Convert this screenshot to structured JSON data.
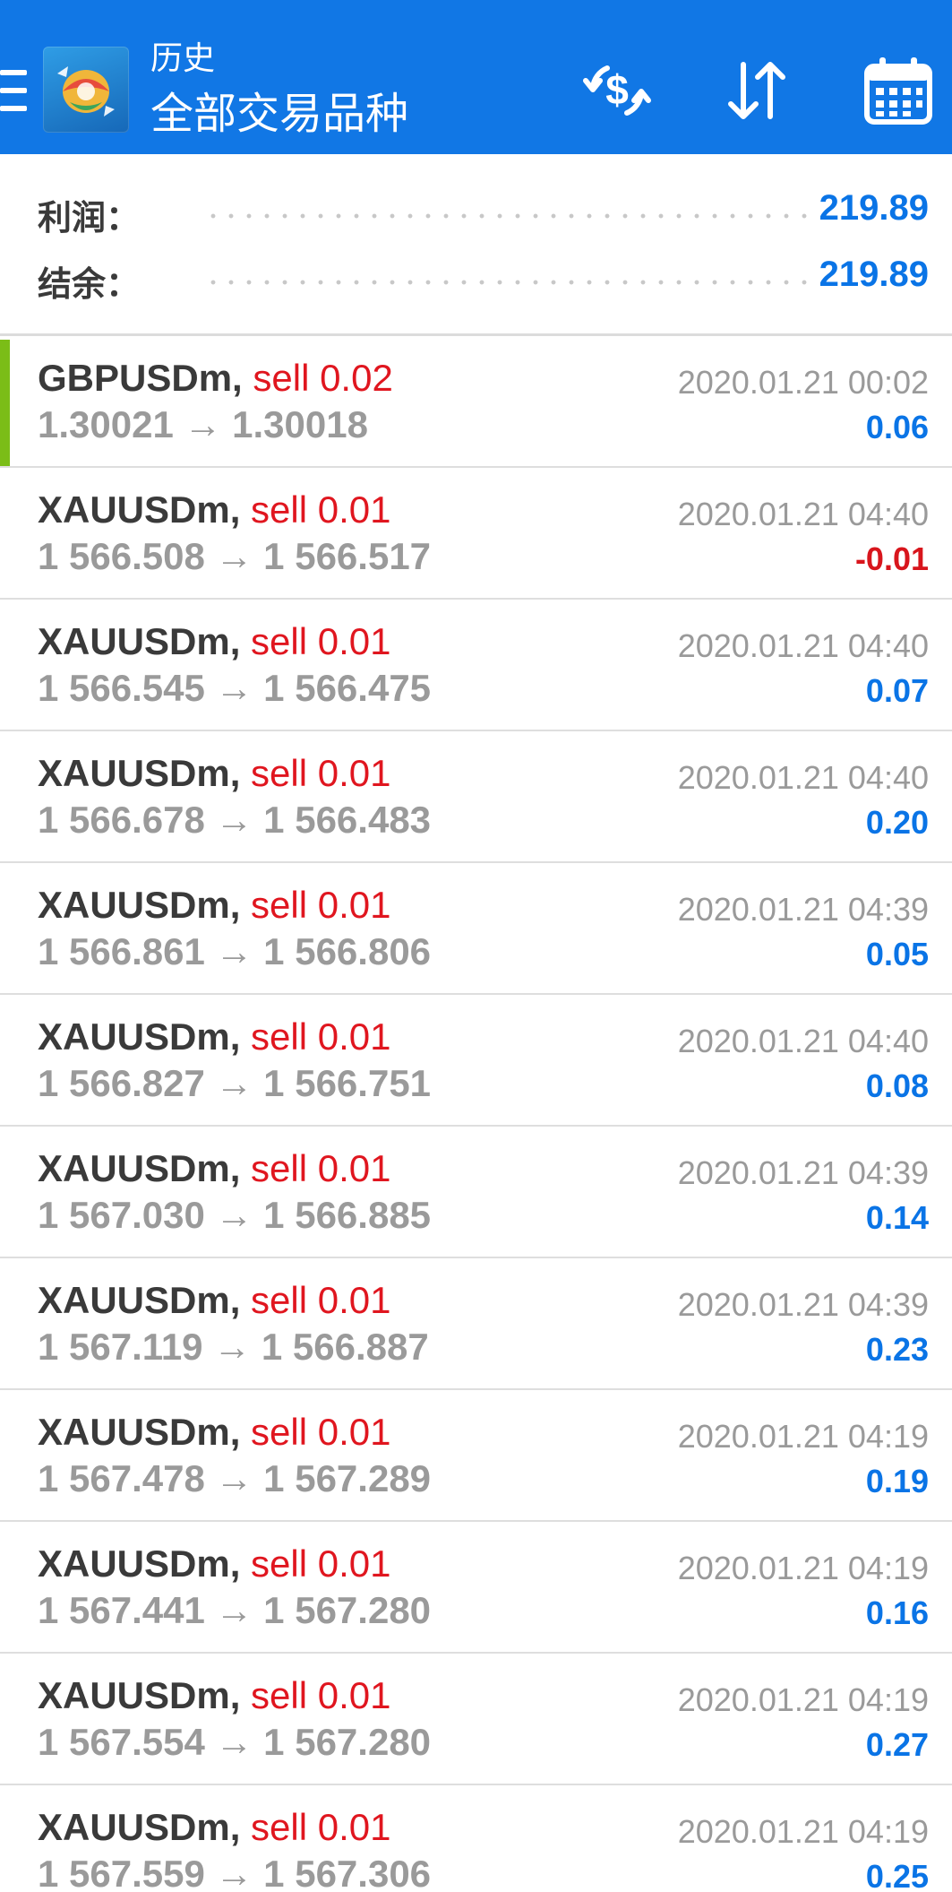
{
  "header": {
    "title_sub": "历史",
    "title_main": "全部交易品种",
    "icons": [
      "menu-icon",
      "metatrader-logo",
      "currency-exchange-icon",
      "sort-icon",
      "calendar-icon"
    ]
  },
  "summary": {
    "profit_label": "利润：",
    "profit_value": "219.89",
    "balance_label": "结余：",
    "balance_value": "219.89"
  },
  "colors": {
    "app_bar": "#1177e5",
    "positive": "#0a74e6",
    "negative": "#d8151c",
    "sell": "#e0161f",
    "accent": "#7bbd17"
  },
  "deals": [
    {
      "symbol": "GBPUSDm,",
      "side": "sell 0.02",
      "prices": "1.30021 → 1.30018",
      "time": "2020.01.21 00:02",
      "profit": "0.06",
      "sign": "pos"
    },
    {
      "symbol": "XAUUSDm,",
      "side": "sell 0.01",
      "prices": "1 566.508 → 1 566.517",
      "time": "2020.01.21 04:40",
      "profit": "-0.01",
      "sign": "neg"
    },
    {
      "symbol": "XAUUSDm,",
      "side": "sell 0.01",
      "prices": "1 566.545 → 1 566.475",
      "time": "2020.01.21 04:40",
      "profit": "0.07",
      "sign": "pos"
    },
    {
      "symbol": "XAUUSDm,",
      "side": "sell 0.01",
      "prices": "1 566.678 → 1 566.483",
      "time": "2020.01.21 04:40",
      "profit": "0.20",
      "sign": "pos"
    },
    {
      "symbol": "XAUUSDm,",
      "side": "sell 0.01",
      "prices": "1 566.861 → 1 566.806",
      "time": "2020.01.21 04:39",
      "profit": "0.05",
      "sign": "pos"
    },
    {
      "symbol": "XAUUSDm,",
      "side": "sell 0.01",
      "prices": "1 566.827 → 1 566.751",
      "time": "2020.01.21 04:40",
      "profit": "0.08",
      "sign": "pos"
    },
    {
      "symbol": "XAUUSDm,",
      "side": "sell 0.01",
      "prices": "1 567.030 → 1 566.885",
      "time": "2020.01.21 04:39",
      "profit": "0.14",
      "sign": "pos"
    },
    {
      "symbol": "XAUUSDm,",
      "side": "sell 0.01",
      "prices": "1 567.119 → 1 566.887",
      "time": "2020.01.21 04:39",
      "profit": "0.23",
      "sign": "pos"
    },
    {
      "symbol": "XAUUSDm,",
      "side": "sell 0.01",
      "prices": "1 567.478 → 1 567.289",
      "time": "2020.01.21 04:19",
      "profit": "0.19",
      "sign": "pos"
    },
    {
      "symbol": "XAUUSDm,",
      "side": "sell 0.01",
      "prices": "1 567.441 → 1 567.280",
      "time": "2020.01.21 04:19",
      "profit": "0.16",
      "sign": "pos"
    },
    {
      "symbol": "XAUUSDm,",
      "side": "sell 0.01",
      "prices": "1 567.554 → 1 567.280",
      "time": "2020.01.21 04:19",
      "profit": "0.27",
      "sign": "pos"
    },
    {
      "symbol": "XAUUSDm,",
      "side": "sell 0.01",
      "prices": "1 567.559 → 1 567.306",
      "time": "2020.01.21 04:19",
      "profit": "0.25",
      "sign": "pos"
    }
  ]
}
